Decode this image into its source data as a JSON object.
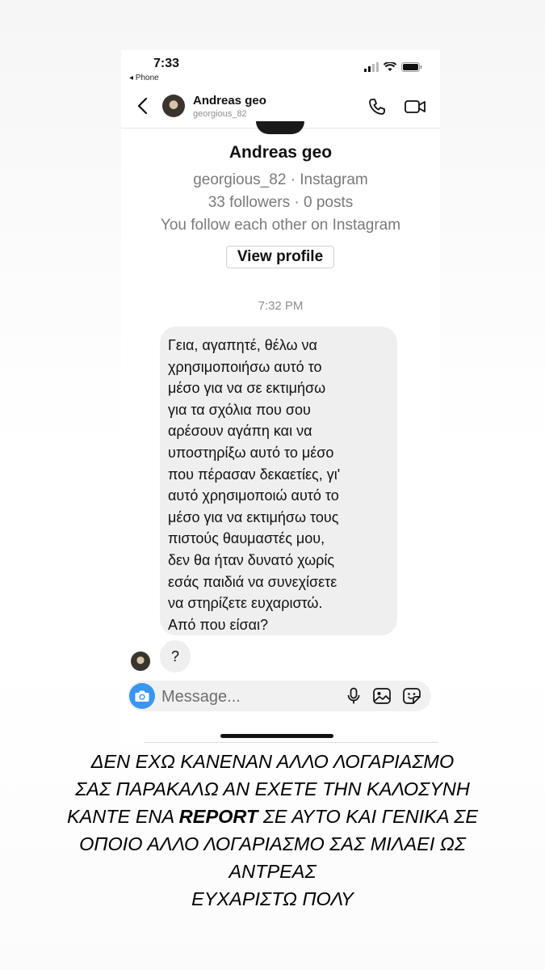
{
  "status_bar": {
    "time": "7:33",
    "back_app": "◂ Phone"
  },
  "header": {
    "name": "Andreas geo",
    "username": "georgious_82"
  },
  "profile": {
    "name": "Andreas geo",
    "subtitle": "georgious_82 · Instagram",
    "stats": "33 followers · 0 posts",
    "relation": "You follow each other on Instagram",
    "view_profile_label": "View profile"
  },
  "conversation": {
    "timestamp": "7:32 PM",
    "messages": [
      {
        "sender": "contact",
        "lines": [
          "Γεια, αγαπητέ, θέλω να",
          "χρησιμοποιήσω αυτό το",
          "μέσο για να σε εκτιμήσω",
          "για τα σχόλια που σου",
          "αρέσουν αγάπη και να",
          "υποστηρίξω αυτό το μέσο",
          "που πέρασαν δεκαετίες, γι'",
          "αυτό χρησιμοποιώ αυτό το",
          "μέσο για να εκτιμήσω τους",
          "πιστούς θαυμαστές μου,",
          "δεν θα ήταν δυνατό χωρίς",
          "εσάς παιδιά να συνεχίσετε",
          "να στηρίζετε ευχαριστώ.",
          "Από που είσαι?"
        ]
      },
      {
        "sender": "contact",
        "text": "?"
      }
    ]
  },
  "composer": {
    "placeholder": "Message..."
  },
  "icons": {
    "back": "chevron-left-icon",
    "call": "phone-icon",
    "video": "video-camera-icon",
    "camera": "camera-icon",
    "mic": "microphone-icon",
    "gallery": "gallery-icon",
    "sticker": "sticker-icon"
  },
  "colors": {
    "camera_button": "#3797f0",
    "bubble": "#efefef",
    "secondary_text": "#8e8e8e"
  },
  "caption": {
    "line1": "ΔΕΝ ΕΧΩ ΚΑΝΕΝΑΝ ΑΛΛΟ ΛΟΓΑΡΙΑΣΜΟ",
    "line2": "ΣΑΣ ΠΑΡΑΚΑΛΩ ΑΝ ΕΧΕΤΕ ΤΗΝ ΚΑΛΟΣΥΝΗ",
    "line3_pre": "ΚΑΝΤΕ ΕΝΑ ",
    "line3_bold": "REPORT",
    "line3_post": " ΣΕ ΑΥΤΟ ΚΑΙ ΓΕΝΙΚΑ ΣΕ",
    "line4": "ΟΠΟΙΟ ΑΛΛΟ ΛΟΓΑΡΙΑΣΜΟ ΣΑΣ ΜΙΛΑΕΙ ΩΣ",
    "line5": "ΑΝΤΡΕΑΣ",
    "line6": "ΕΥΧΑΡΙΣΤΩ ΠΟΛΥ"
  }
}
